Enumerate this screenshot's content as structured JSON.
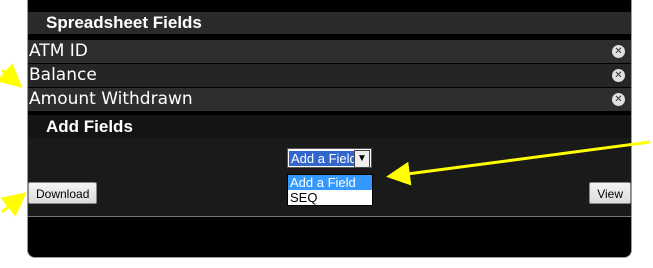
{
  "spreadsheet_fields": {
    "title": "Spreadsheet Fields",
    "items": [
      {
        "label": "ATM ID"
      },
      {
        "label": "Balance"
      },
      {
        "label": "Amount Withdrawn"
      }
    ],
    "remove_icon": "close-circle-icon"
  },
  "add_fields": {
    "title": "Add Fields",
    "select_value": "Add a Field",
    "options": [
      "Add a Field",
      "SEQ"
    ]
  },
  "buttons": {
    "download_label": "Download",
    "view_label": "View"
  },
  "colors": {
    "annotation_arrow": "#ffff00",
    "panel_background": "#000000",
    "selected_option": "#3399ff"
  }
}
